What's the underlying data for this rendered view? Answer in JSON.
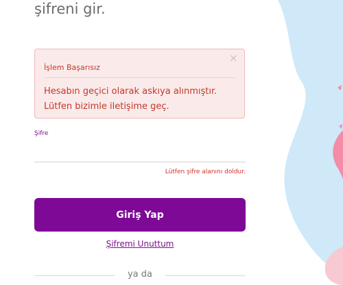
{
  "heading": "şifreni gir.",
  "alert": {
    "title": "İşlem Başarısız",
    "message": "Hesabın geçici olarak askıya alınmıştır. Lütfen bizimle iletişime geç.",
    "close": "×"
  },
  "password": {
    "label": "Şifre",
    "value": "",
    "error": "Lütfen şifre alanını doldur."
  },
  "login_button": "Giriş Yap",
  "forgot_link": "Şifremi Unuttum",
  "or_text": "ya da",
  "colors": {
    "brand": "#7e0997",
    "error": "#c0392b",
    "alert_bg": "#fbeaea",
    "decor_blue": "#cfe9f8",
    "decor_pink": "#f6c9d3"
  }
}
